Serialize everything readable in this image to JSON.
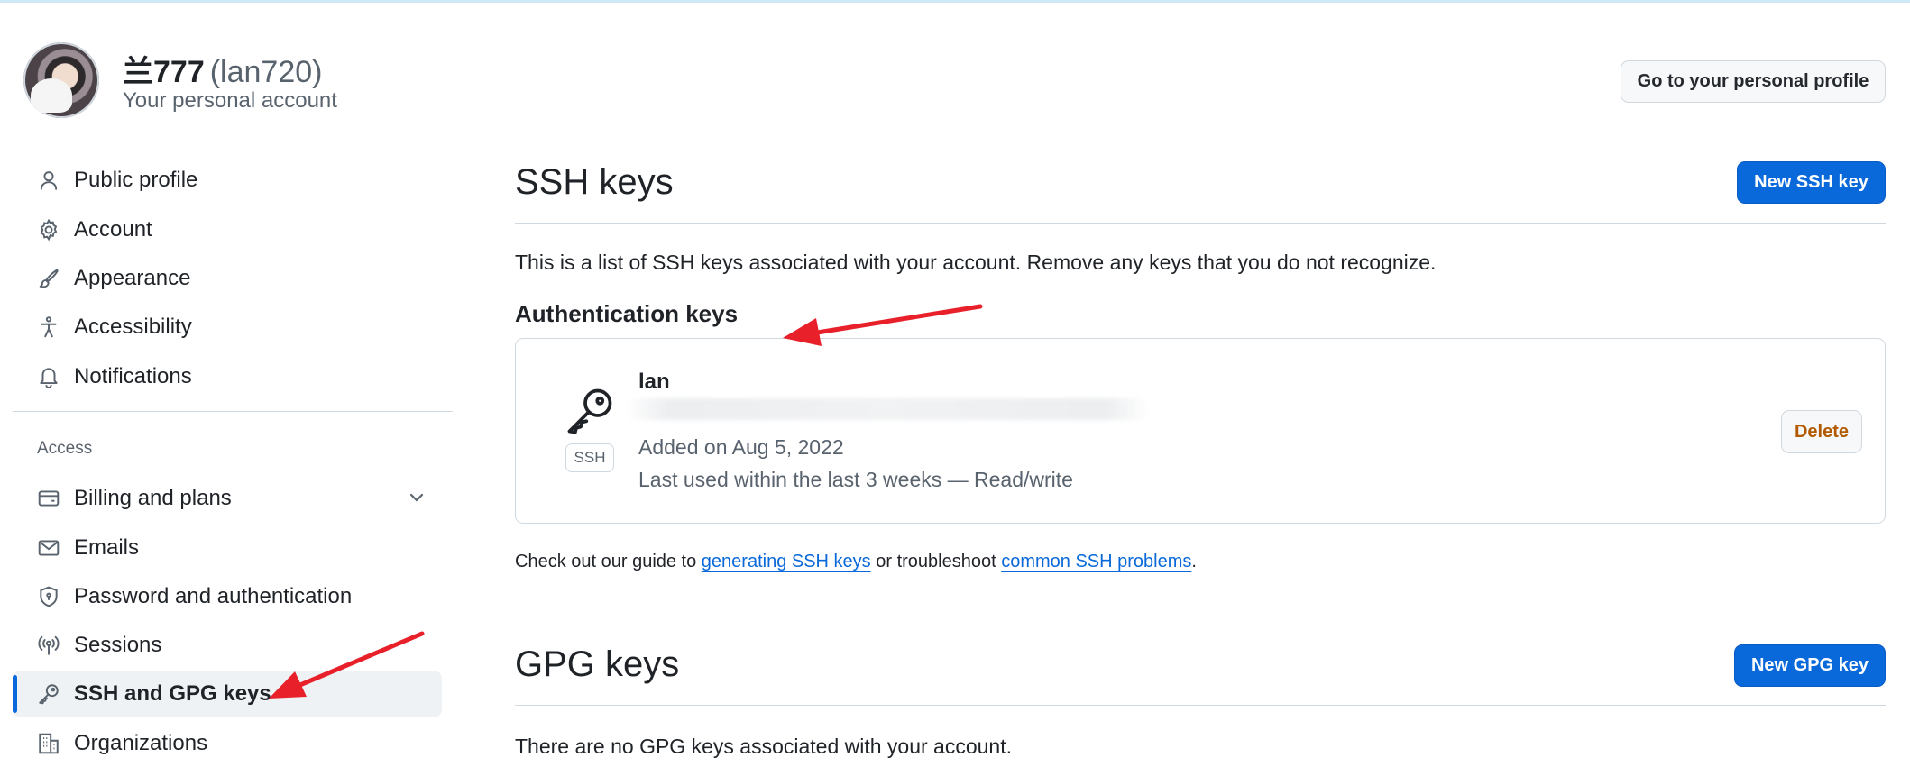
{
  "header": {
    "display_name": "兰777",
    "login": "(lan720)",
    "subtitle": "Your personal account",
    "profile_button": "Go to your personal profile"
  },
  "sidebar": {
    "items": [
      {
        "label": "Public profile",
        "icon": "person-icon"
      },
      {
        "label": "Account",
        "icon": "gear-icon"
      },
      {
        "label": "Appearance",
        "icon": "paintbrush-icon"
      },
      {
        "label": "Accessibility",
        "icon": "accessibility-icon"
      },
      {
        "label": "Notifications",
        "icon": "bell-icon"
      }
    ],
    "access_heading": "Access",
    "access_items": [
      {
        "label": "Billing and plans",
        "icon": "credit-card-icon"
      },
      {
        "label": "Emails",
        "icon": "mail-icon"
      },
      {
        "label": "Password and authentication",
        "icon": "shield-lock-icon"
      },
      {
        "label": "Sessions",
        "icon": "broadcast-icon"
      },
      {
        "label": "SSH and GPG keys",
        "icon": "key-icon",
        "active": true
      },
      {
        "label": "Organizations",
        "icon": "organization-icon"
      }
    ]
  },
  "ssh": {
    "title": "SSH keys",
    "new_button": "New SSH key",
    "description": "This is a list of SSH keys associated with your account. Remove any keys that you do not recognize.",
    "auth_heading": "Authentication keys",
    "key": {
      "badge": "SSH",
      "title": "lan",
      "added": "Added on Aug 5, 2022",
      "last_used": "Last used within the last 3 weeks — Read/write",
      "delete_button": "Delete"
    },
    "guide_prefix": "Check out our guide to ",
    "guide_link1": "generating SSH keys",
    "guide_middle": " or troubleshoot ",
    "guide_link2": "common SSH problems",
    "guide_suffix": "."
  },
  "gpg": {
    "title": "GPG keys",
    "new_button": "New GPG key",
    "empty_text": "There are no GPG keys associated with your account."
  },
  "colors": {
    "accent": "#0969da",
    "annotation_arrow": "#e8202a",
    "danger_text": "#b35900"
  }
}
